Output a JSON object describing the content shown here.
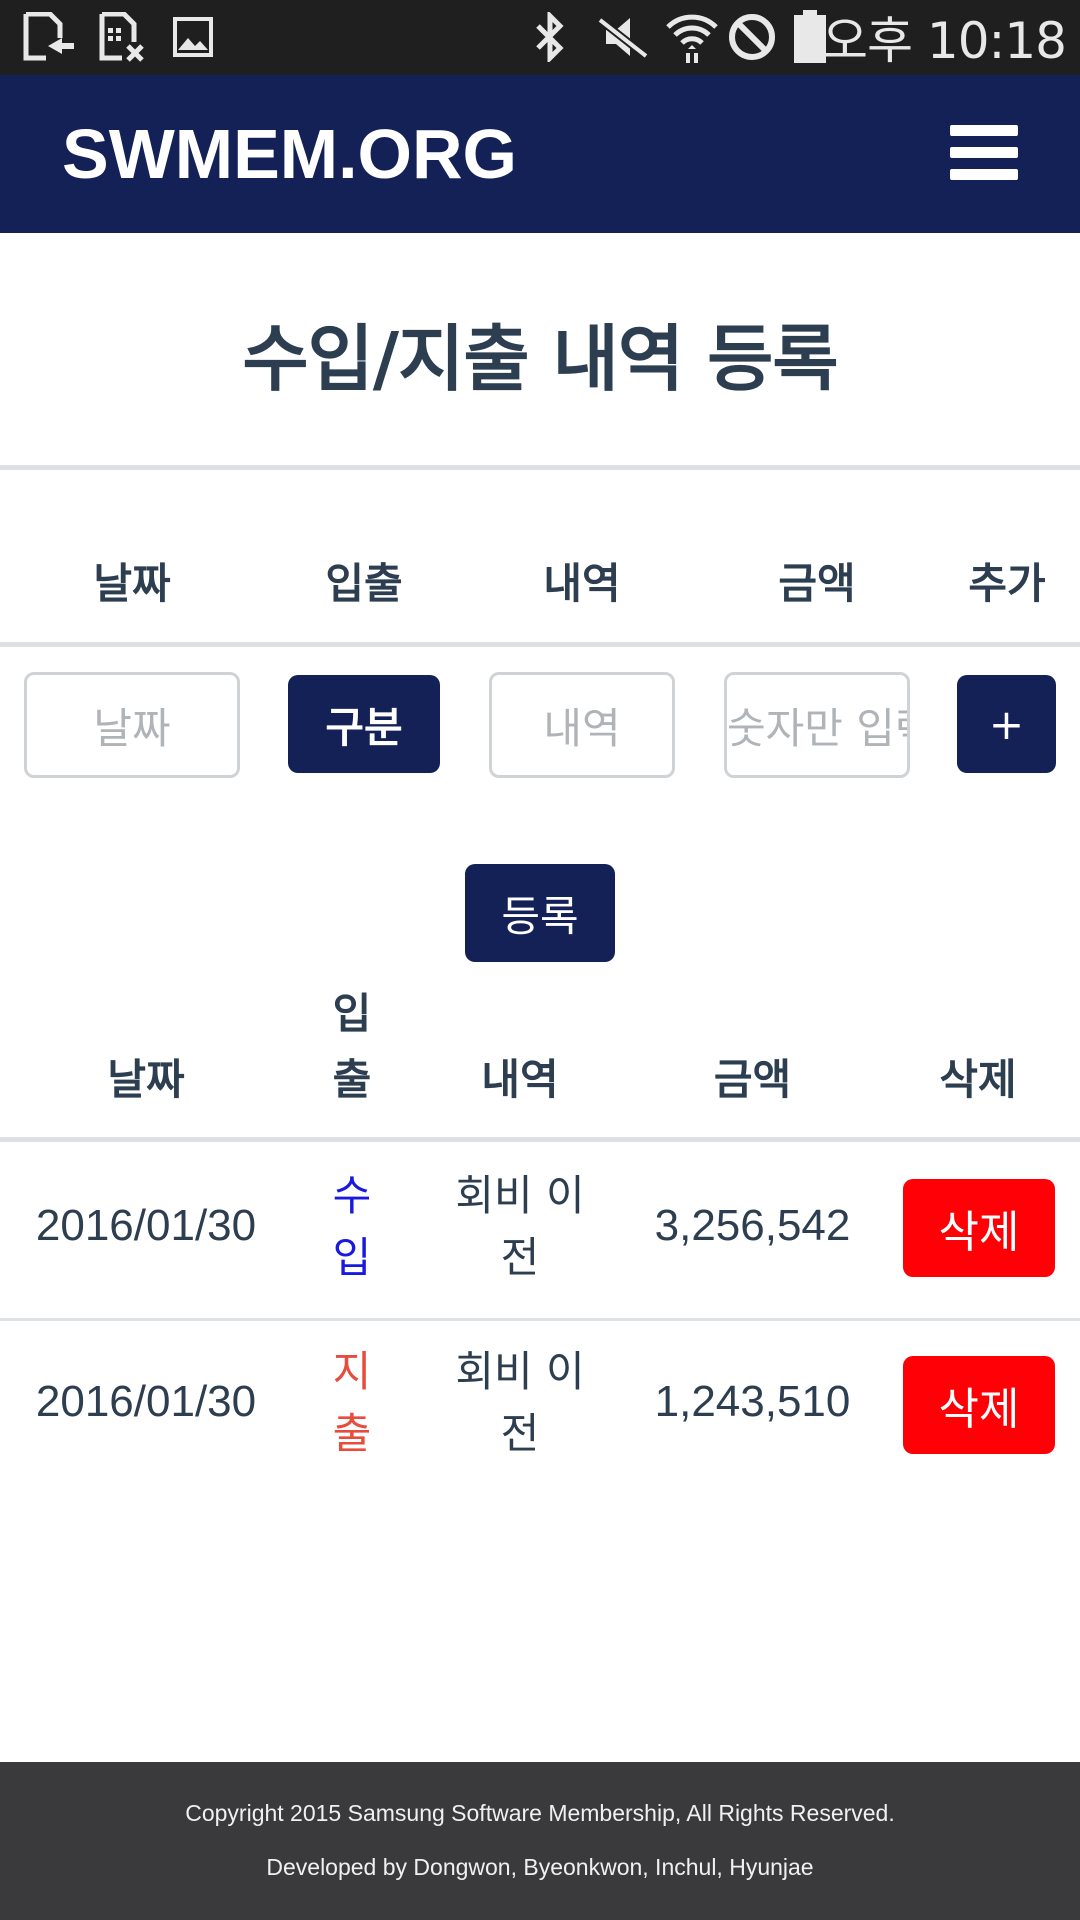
{
  "status_bar": {
    "time": "오후 10:18",
    "icons": [
      "file-upload-icon",
      "sim-card-off-icon",
      "image-icon",
      "bluetooth-icon",
      "mute-icon",
      "wifi-icon",
      "do-not-disturb-icon",
      "battery-icon"
    ]
  },
  "navbar": {
    "brand": "SWMEM.ORG",
    "menu_icon": "hamburger-menu-icon"
  },
  "page": {
    "title": "수입/지출 내역 등록"
  },
  "form": {
    "headers": [
      "날짜",
      "입출",
      "내역",
      "금액",
      "추가"
    ],
    "date_placeholder": "날짜",
    "type_button": "구분",
    "item_placeholder": "내역",
    "amount_placeholder": "숫자만 입력",
    "add_button": "+",
    "submit_button": "등록"
  },
  "table": {
    "headers": {
      "date": "날짜",
      "type_line1": "입",
      "type_line2": "출",
      "item": "내역",
      "amount": "금액",
      "delete": "삭제"
    },
    "rows": [
      {
        "date": "2016/01/30",
        "type_line1": "수",
        "type_line2": "입",
        "item_line1": "회비 이",
        "item_line2": "전",
        "amount": "3,256,542",
        "delete_label": "삭제"
      },
      {
        "date": "2016/01/30",
        "type_line1": "지",
        "type_line2": "출",
        "item_line1": "회비 이",
        "item_line2": "전",
        "amount": "1,243,510",
        "delete_label": "삭제"
      }
    ]
  },
  "footer": {
    "copyright": "Copyright 2015 Samsung Software Membership, All Rights Reserved.",
    "developers": "Developed by Dongwon, Byeonkwon, Inchul, Hyunjae"
  },
  "colors": {
    "navbar": "#142157",
    "statusbar": "#1f1f1f",
    "text": "#2c3e50",
    "income": "#1a1adf",
    "expense": "#e74c3c",
    "delete": "#fe0006",
    "footer": "#3a3a3c"
  }
}
